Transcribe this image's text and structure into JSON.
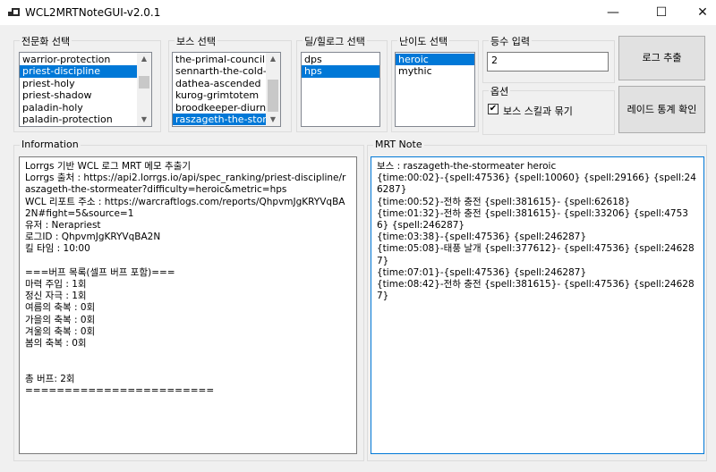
{
  "window": {
    "title": "WCL2MRTNoteGUI-v2.0.1",
    "controls": {
      "minimize": "—",
      "maximize": "☐",
      "close": "✕"
    }
  },
  "groups": {
    "spec": {
      "label": "전문화 선택",
      "items": [
        "warrior-protection",
        "priest-discipline",
        "priest-holy",
        "priest-shadow",
        "paladin-holy",
        "paladin-protection"
      ],
      "selected": "priest-discipline"
    },
    "boss": {
      "label": "보스 선택",
      "items": [
        "the-primal-council",
        "sennarth-the-cold-breath",
        "dathea-ascended",
        "kurog-grimtotem",
        "broodkeeper-diurna",
        "raszageth-the-stormeater"
      ],
      "selected": "raszageth-the-stormeater"
    },
    "role": {
      "label": "딜/힐로그 선택",
      "items": [
        "dps",
        "hps"
      ],
      "selected": "hps"
    },
    "difficulty": {
      "label": "난이도 선택",
      "items": [
        "heroic",
        "mythic"
      ],
      "selected": "heroic"
    },
    "rank": {
      "label": "등수 입력",
      "value": "2"
    },
    "options": {
      "label": "옵션",
      "checkbox_label": "보스 스킬과 묶기",
      "checked": true
    }
  },
  "buttons": {
    "extract": "로그 추출",
    "raid_stats": "레이드 통계 확인"
  },
  "information": {
    "label": "Information",
    "lines": [
      "Lorrgs 기반 WCL 로그 MRT 메모 추출기",
      "Lorrgs 출처 : https://api2.lorrgs.io/api/spec_ranking/priest-discipline/raszageth-the-stormeater?difficulty=heroic&metric=hps",
      "WCL 리포트 주소 : https://warcraftlogs.com/reports/QhpvmJgKRYVqBA2N#fight=5&source=1",
      "유저 : Nerapriest",
      "로그ID : QhpvmJgKRYVqBA2N",
      "킬 타임 : 10:00",
      "",
      "===버프 목록(셀프 버프 포함)===",
      "마력 주입 : 1회",
      "정신 자극 : 1회",
      "여름의 축복 : 0회",
      "가을의 축복 : 0회",
      "겨울의 축복 : 0회",
      "봄의 축복 : 0회",
      "",
      "",
      "총 버프: 2회",
      "========================"
    ]
  },
  "mrt_note": {
    "label": "MRT Note",
    "lines": [
      "보스 : raszageth-the-stormeater heroic",
      "{time:00:02}-{spell:47536} {spell:10060} {spell:29166} {spell:246287}",
      "{time:00:52}-전하 충전 {spell:381615}- {spell:62618}",
      "{time:01:32}-전하 충전 {spell:381615}- {spell:33206} {spell:47536} {spell:246287}",
      "{time:03:38}-{spell:47536} {spell:246287}",
      "{time:05:08}-태풍 날개 {spell:377612}- {spell:47536} {spell:246287}",
      "{time:07:01}-{spell:47536} {spell:246287}",
      "{time:08:42}-전하 충전 {spell:381615}- {spell:47536} {spell:246287}"
    ]
  }
}
